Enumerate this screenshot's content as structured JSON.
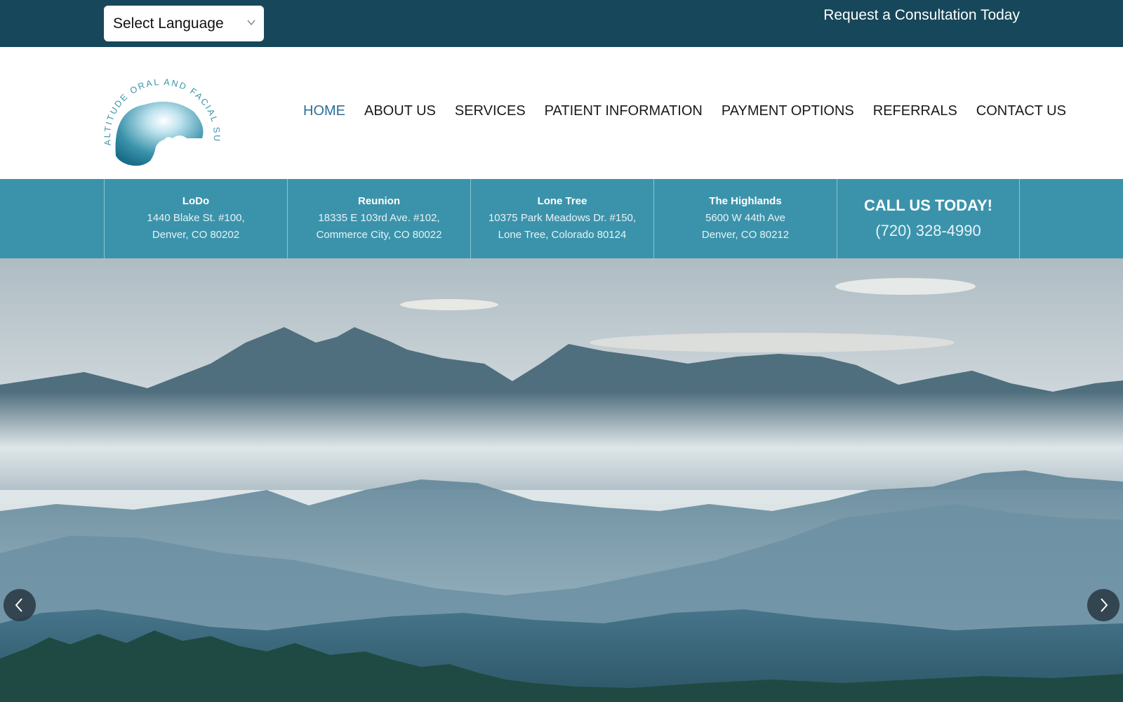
{
  "topbar": {
    "language_select": "Select Language",
    "consultation_link": "Request a Consultation Today"
  },
  "logo": {
    "text": "ALTITUDE ORAL AND FACIAL SURGERY"
  },
  "nav": {
    "items": [
      {
        "label": "HOME",
        "active": true
      },
      {
        "label": "ABOUT US"
      },
      {
        "label": "SERVICES"
      },
      {
        "label": "PATIENT INFORMATION"
      },
      {
        "label": "PAYMENT OPTIONS"
      },
      {
        "label": "REFERRALS"
      },
      {
        "label": "CONTACT US"
      }
    ]
  },
  "locations": [
    {
      "name": "LoDo",
      "line1": "1440 Blake St. #100,",
      "line2": "Denver, CO 80202"
    },
    {
      "name": "Reunion",
      "line1": "18335 E 103rd Ave. #102,",
      "line2": "Commerce City, CO 80022"
    },
    {
      "name": "Lone Tree",
      "line1": "10375 Park Meadows Dr. #150,",
      "line2": "Lone Tree, Colorado 80124"
    },
    {
      "name": "The Highlands",
      "line1": "5600 W 44th Ave",
      "line2": "Denver, CO 80212"
    }
  ],
  "call": {
    "title": "CALL US TODAY!",
    "phone": "(720) 328-4990"
  },
  "icons": {
    "language_dropdown": "chevron-down-icon",
    "slider_prev": "chevron-left-icon",
    "slider_next": "chevron-right-icon"
  },
  "colors": {
    "topbar": "#17475a",
    "location_strip": "#3b93ab",
    "nav_active": "#2f6e98"
  }
}
